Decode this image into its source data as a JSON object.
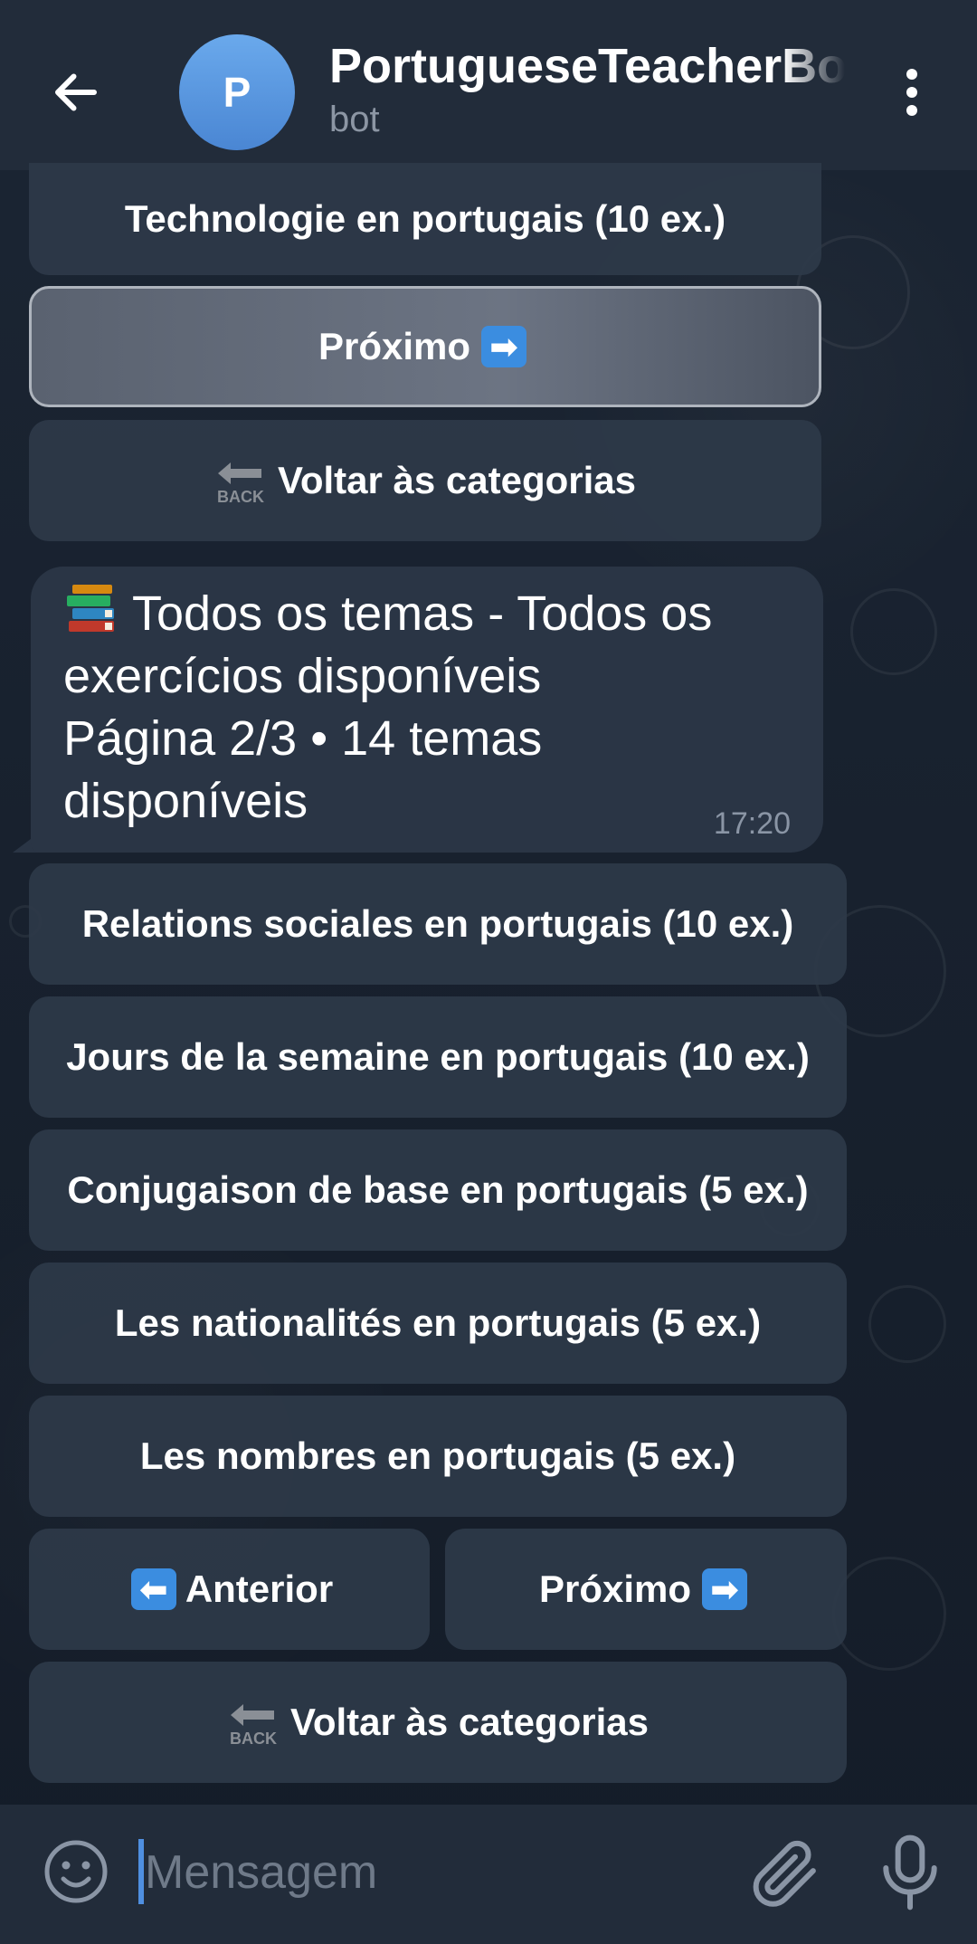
{
  "header": {
    "title": "PortugueseTeacherBot",
    "subtitle": "bot",
    "avatar_letter": "P",
    "avatar_color": "#5a9be2",
    "back_icon": "arrow-left-icon",
    "menu_icon": "more-vertical-icon"
  },
  "top_keyboard": {
    "topic_button": "Technologie en portugais (10 ex.)",
    "next_label": "Próximo",
    "back_label": "Voltar às categorias"
  },
  "message": {
    "icon": "books-icon",
    "line1": "Todos os temas - Todos os exercícios disponíveis",
    "line2": "Página 2/3 • 14 temas disponíveis",
    "time": "17:20"
  },
  "keyboard": {
    "topics": [
      "Relations sociales en portugais (10 ex.)",
      "Jours de la semaine en portugais (10 ex.)",
      "Conjugaison de base en portugais (5 ex.)",
      "Les nationalités en portugais (5 ex.)",
      "Les nombres en portugais (5 ex.)"
    ],
    "prev_label": "Anterior",
    "next_label": "Próximo",
    "back_label": "Voltar às categorias",
    "back_emoji_text": "BACK"
  },
  "input": {
    "placeholder": "Mensagem",
    "emoji_icon": "smile-icon",
    "attach_icon": "paperclip-icon",
    "mic_icon": "microphone-icon"
  },
  "colors": {
    "header_bg": "#222c3a",
    "chat_bg": "#172130",
    "button_bg": "#2e3949",
    "bubble_bg": "#2a3545",
    "accent": "#4f8fe0"
  }
}
